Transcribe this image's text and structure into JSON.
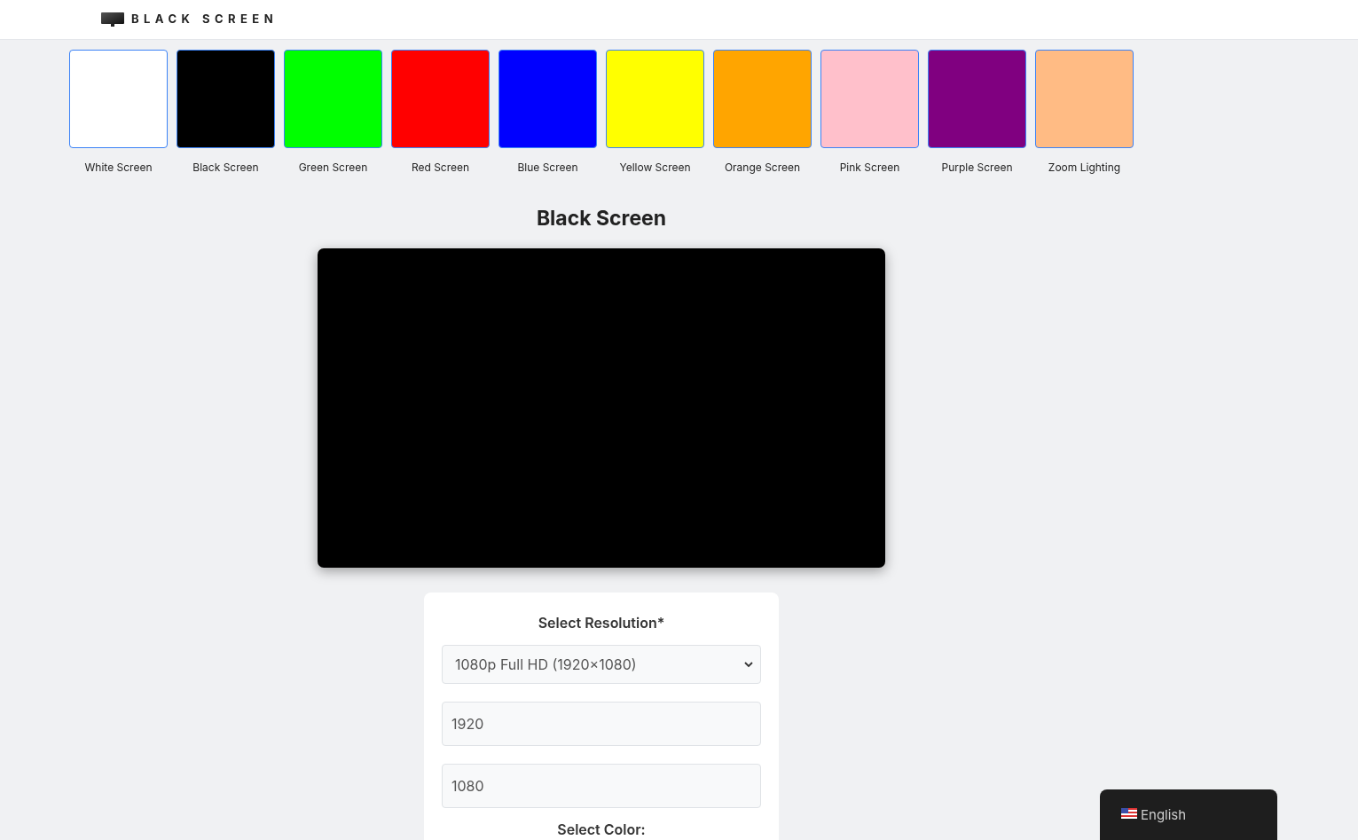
{
  "header": {
    "logo_text": "BLACK SCREEN"
  },
  "swatches": [
    {
      "label": "White Screen",
      "color": "#ffffff"
    },
    {
      "label": "Black Screen",
      "color": "#000000"
    },
    {
      "label": "Green Screen",
      "color": "#00ff00"
    },
    {
      "label": "Red Screen",
      "color": "#ff0000"
    },
    {
      "label": "Blue Screen",
      "color": "#0000ff"
    },
    {
      "label": "Yellow Screen",
      "color": "#ffff00"
    },
    {
      "label": "Orange Screen",
      "color": "#ffa500"
    },
    {
      "label": "Pink Screen",
      "color": "#ffc0cb"
    },
    {
      "label": "Purple Screen",
      "color": "#800080"
    },
    {
      "label": "Zoom Lighting",
      "color": "#ffbb84"
    }
  ],
  "title": "Black Screen",
  "settings": {
    "resolution_label": "Select Resolution*",
    "resolution_value": "1080p Full HD (1920×1080)",
    "width_value": "1920",
    "height_value": "1080",
    "color_label": "Select Color:"
  },
  "language": {
    "label": "English"
  }
}
